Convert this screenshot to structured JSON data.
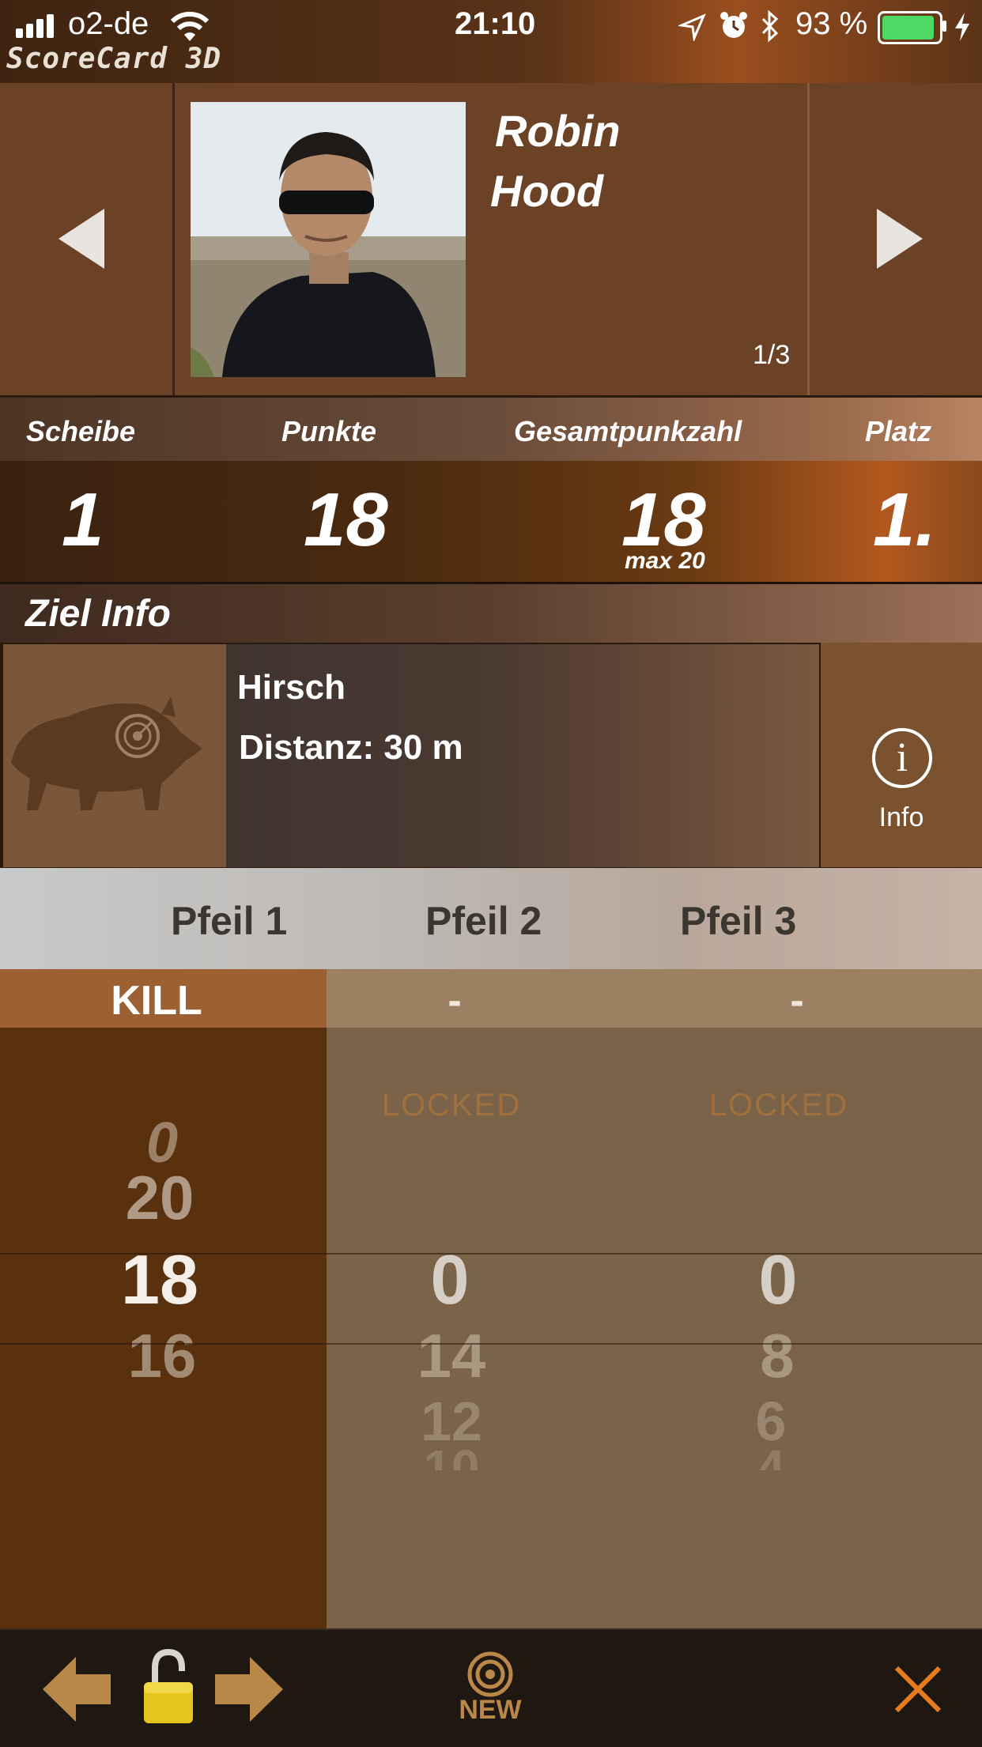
{
  "status": {
    "carrier": "o2-de",
    "time": "21:10",
    "battery": "93 %",
    "battery_level": 0.93,
    "battery_color": "#4cd964"
  },
  "app": {
    "title": "ScoreCard 3D"
  },
  "player": {
    "first_name": "Robin",
    "last_name": "Hood",
    "page": "1/3"
  },
  "stats": {
    "headers": {
      "target": "Scheibe",
      "points": "Punkte",
      "total": "Gesamtpunkzahl",
      "rank": "Platz"
    },
    "values": {
      "target": "1",
      "points": "18",
      "total": "18",
      "max": "max 20",
      "rank": "1."
    }
  },
  "target_info": {
    "header": "Ziel Info",
    "name": "Hirsch",
    "distance": "Distanz: 30 m",
    "info_label": "Info"
  },
  "arrows": {
    "headers": [
      "Pfeil 1",
      "Pfeil 2",
      "Pfeil 3"
    ],
    "zones": [
      "KILL",
      "-",
      "-"
    ],
    "locked_label": "LOCKED",
    "picker_1": {
      "above": [
        "0",
        "20"
      ],
      "selected": "18",
      "below": [
        "16"
      ]
    },
    "picker_2": {
      "selected": "0",
      "below": [
        "14",
        "12",
        "10"
      ]
    },
    "picker_3": {
      "selected": "0",
      "below": [
        "8",
        "6",
        "4"
      ]
    }
  },
  "toolbar": {
    "new_label": "NEW"
  },
  "colors": {
    "accent": "#b98748",
    "close": "#e87a1e",
    "lock": "#e3c51e"
  }
}
